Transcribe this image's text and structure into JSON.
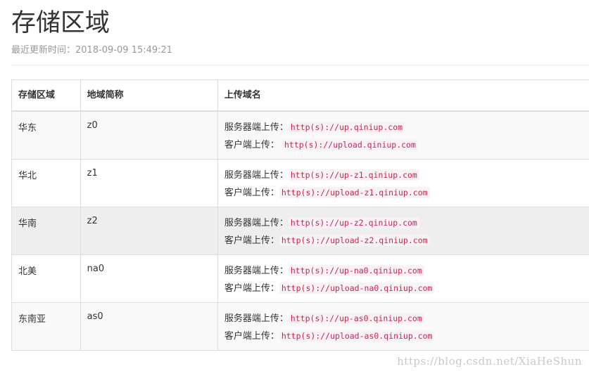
{
  "page": {
    "title": "存储区域",
    "updated": "最近更新时间：2018-09-09 15:49:21"
  },
  "table": {
    "headers": [
      "存储区域",
      "地域简称",
      "上传域名"
    ],
    "rows": [
      {
        "region": "华东",
        "code": "z0",
        "server_label": "服务器端上传：",
        "server_url": "http(s)://up.qiniup.com",
        "client_label": "客户端上传：",
        "client_url": "http(s)://upload.qiniup.com"
      },
      {
        "region": "华北",
        "code": "z1",
        "server_label": "服务器端上传：",
        "server_url": "http(s)://up-z1.qiniup.com",
        "client_label": "客户端上传：",
        "client_url": "http(s)://upload-z1.qiniup.com"
      },
      {
        "region": "华南",
        "code": "z2",
        "server_label": "服务器端上传：",
        "server_url": "http(s)://up-z2.qiniup.com",
        "client_label": "客户端上传：",
        "client_url": "http(s)://upload-z2.qiniup.com"
      },
      {
        "region": "北美",
        "code": "na0",
        "server_label": "服务器端上传：",
        "server_url": "http(s)://up-na0.qiniup.com",
        "client_label": "客户端上传：",
        "client_url": "http(s)://upload-na0.qiniup.com"
      },
      {
        "region": "东南亚",
        "code": "as0",
        "server_label": "服务器端上传：",
        "server_url": "http(s)://up-as0.qiniup.com",
        "client_label": "客户端上传：",
        "client_url": "http(s)://upload-as0.qiniup.com"
      }
    ]
  },
  "watermark": "https://blog.csdn.net/XiaHeShun",
  "colors": {
    "code_text": "#c7254e",
    "code_bg": "#f9f2f4",
    "row_stripe": "#f9f9f9",
    "row_highlight": "#eeeeee",
    "border": "#dddddd"
  }
}
